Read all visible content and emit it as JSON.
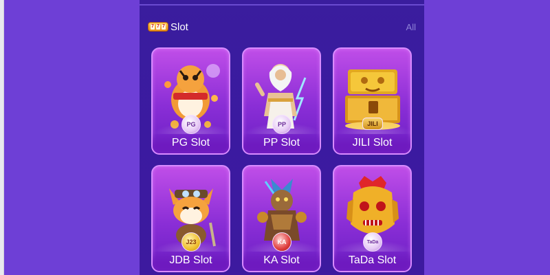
{
  "header": {
    "title": "Slot",
    "all_label": "All"
  },
  "cards": [
    {
      "label": "PG Slot",
      "badge": "PG",
      "icon": "tiger-icon"
    },
    {
      "label": "PP Slot",
      "badge": "PP",
      "icon": "zeus-icon"
    },
    {
      "label": "JILI Slot",
      "badge": "JILI",
      "icon": "treasure-chest-icon"
    },
    {
      "label": "JDB Slot",
      "badge": "J23",
      "icon": "fox-adventurer-icon"
    },
    {
      "label": "KA Slot",
      "badge": "KA",
      "icon": "warrior-icon"
    },
    {
      "label": "TaDa Slot",
      "badge": "TaDa",
      "icon": "golden-mask-icon"
    }
  ],
  "colors": {
    "page_bg": "#6e3fd6",
    "panel_bg": "#3b1aa0",
    "card_accent": "#c04ee8"
  }
}
